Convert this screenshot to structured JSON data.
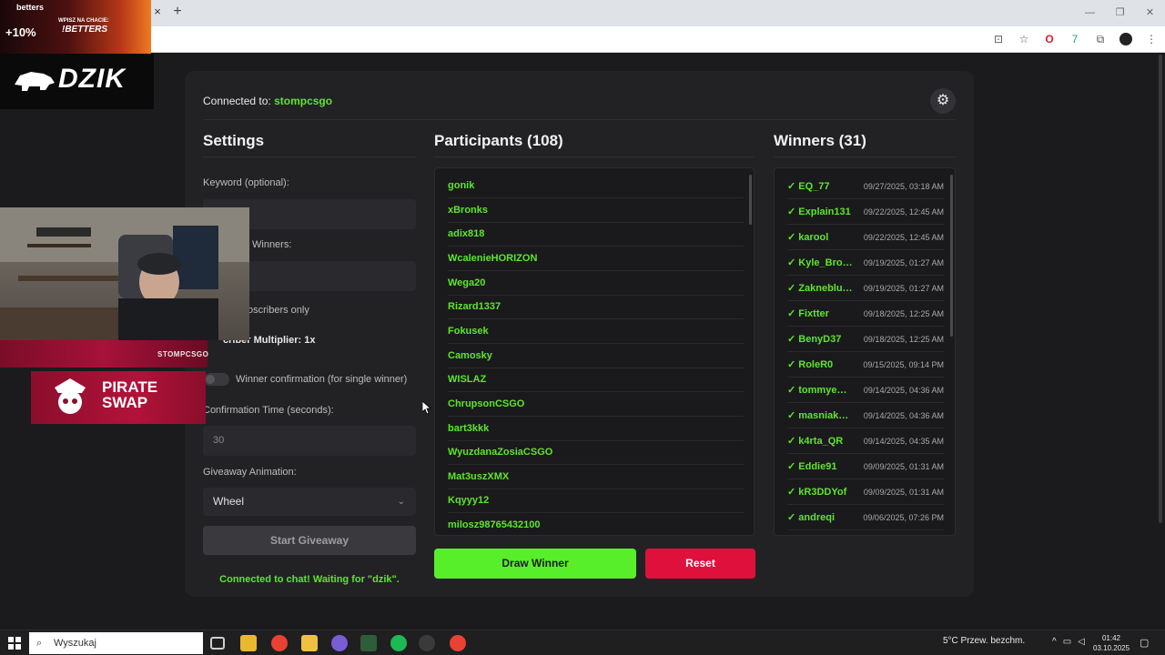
{
  "browser": {
    "tab_close": "×",
    "new_tab": "+",
    "window_controls": [
      "—",
      "❐",
      "✕"
    ]
  },
  "overlay": {
    "ad_brand": "betters",
    "ad_bonus": "+10%",
    "ad_headline": "WPISZ NA CHACIE:",
    "ad_code": "!BETTERS",
    "logo": "DZIK",
    "cam_handle": "STOMPCSGO",
    "sponsor": "PIRATE SWAP"
  },
  "app": {
    "connected_label": "Connected to:",
    "channel": "stompcsgo",
    "settings_title": "Settings",
    "keyword_label": "Keyword (optional):",
    "winners_label": "Winners:",
    "subscribers_label": "oscribers only",
    "multiplier_label": "criber Multiplier: 1x",
    "confirmation_label": "Winner confirmation (for single winner)",
    "confirmation_time_label": "Confirmation Time (seconds):",
    "confirmation_time_value": "30",
    "animation_label": "Giveaway Animation:",
    "animation_value": "Wheel",
    "start_button": "Start Giveaway",
    "status": "Connected to chat! Waiting for \"dzik\".",
    "participants_title": "Participants (108)",
    "participants": [
      "gonik",
      "xBronks",
      "adix818",
      "WcalenieHORIZON",
      "Wega20",
      "Rizard1337",
      "Fokusek",
      "Camosky",
      "WISLAZ",
      "ChrupsonCSGO",
      "bart3kkk",
      "WyuzdanaZosiaCSGO",
      "Mat3uszXMX",
      "Kqyyy12",
      "milosz98765432100"
    ],
    "draw_button": "Draw Winner",
    "reset_button": "Reset",
    "winners_title": "Winners (31)",
    "winners": [
      {
        "name": "✓ EQ_77",
        "date": "09/27/2025, 03:18 AM"
      },
      {
        "name": "✓ Explain131",
        "date": "09/22/2025, 12:45 AM"
      },
      {
        "name": "✓ karool",
        "date": "09/22/2025, 12:45 AM"
      },
      {
        "name": "✓ Kyle_Bro…",
        "date": "09/19/2025, 01:27 AM"
      },
      {
        "name": "✓ Zakneblu…",
        "date": "09/19/2025, 01:27 AM"
      },
      {
        "name": "✓ Fixtter",
        "date": "09/18/2025, 12:25 AM"
      },
      {
        "name": "✓ BenyD37",
        "date": "09/18/2025, 12:25 AM"
      },
      {
        "name": "✓ RoleR0",
        "date": "09/15/2025, 09:14 PM"
      },
      {
        "name": "✓ tommye…",
        "date": "09/14/2025, 04:36 AM"
      },
      {
        "name": "✓ masniak…",
        "date": "09/14/2025, 04:36 AM"
      },
      {
        "name": "✓ k4rta_QR",
        "date": "09/14/2025, 04:35 AM"
      },
      {
        "name": "✓ Eddie91",
        "date": "09/09/2025, 01:31 AM"
      },
      {
        "name": "✓ kR3DDYof",
        "date": "09/09/2025, 01:31 AM"
      },
      {
        "name": "✓ andreqi",
        "date": "09/06/2025, 07:26 PM"
      }
    ],
    "gear_glyph": "⚙",
    "chevron_glyph": "⌄"
  },
  "taskbar": {
    "search_placeholder": "Wyszukaj",
    "weather": "5°C  Przew. bezchm.",
    "time": "01:42",
    "date": "03.10.2025"
  },
  "colors": {
    "accent_green": "#5ee52c",
    "draw_button": "#57ef2a",
    "reset_button": "#e0103d",
    "card": "#222225"
  }
}
